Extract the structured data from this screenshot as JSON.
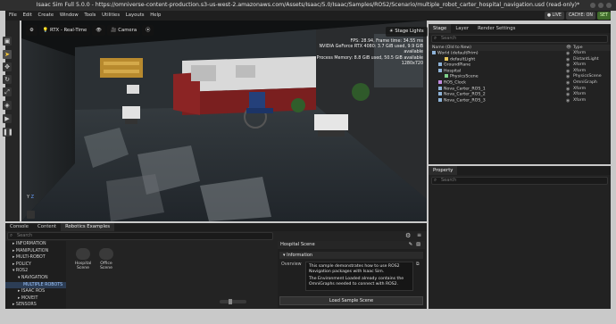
{
  "window": {
    "title": "Isaac Sim Full 5.0.0 - https://omniverse-content-production.s3-us-west-2.amazonaws.com/Assets/Isaac/5.0/Isaac/Samples/ROS2/Scenario/multiple_robot_carter_hospital_navigation.usd (read-only)*"
  },
  "menubar": {
    "items": [
      "File",
      "Edit",
      "Create",
      "Window",
      "Tools",
      "Utilities",
      "Layouts",
      "Help"
    ],
    "live_label": "LIVE",
    "cache_label": "CACHE: ON",
    "set_label": "SET"
  },
  "viewport": {
    "render_mode": "RTX - Real-Time",
    "camera_label": "Camera",
    "stage_lights_label": "Stage Lights",
    "stats": [
      "FPS: 28.94, Frame time: 34.55 ms",
      "NVIDIA GeForce RTX 4080: 3.7 GiB used, 9.9 GiB available",
      "Process Memory: 8.8 GiB used, 50.5 GiB available",
      "1280x720"
    ],
    "axis_label": "Y",
    "axis_label_2": "Z"
  },
  "stage": {
    "tabs": [
      "Stage",
      "Layer",
      "Render Settings"
    ],
    "search_placeholder": "Search",
    "col_name": "Name (Old to New)",
    "col_type": "Type",
    "rows": [
      {
        "label": "World (defaultPrim)",
        "type": "Xform",
        "indent": 0,
        "color": "#8fb4d9"
      },
      {
        "label": "defaultLight",
        "type": "DistantLight",
        "indent": 2,
        "color": "#e6c65a"
      },
      {
        "label": "GroundPlane",
        "type": "Xform",
        "indent": 1,
        "color": "#8fb4d9"
      },
      {
        "label": "Hospital",
        "type": "Xform",
        "indent": 1,
        "color": "#8fb4d9"
      },
      {
        "label": "PhysicsScene",
        "type": "PhysicsScene",
        "indent": 2,
        "color": "#7fd08a"
      },
      {
        "label": "ROS_Clock",
        "type": "OmniGraph",
        "indent": 1,
        "color": "#c28adf"
      },
      {
        "label": "Nova_Carter_ROS_1",
        "type": "Xform",
        "indent": 1,
        "color": "#8fb4d9"
      },
      {
        "label": "Nova_Carter_ROS_2",
        "type": "Xform",
        "indent": 1,
        "color": "#8fb4d9"
      },
      {
        "label": "Nova_Carter_ROS_3",
        "type": "Xform",
        "indent": 1,
        "color": "#8fb4d9"
      }
    ]
  },
  "property": {
    "tab": "Property",
    "search_placeholder": "Search"
  },
  "bottom": {
    "tabs": [
      "Console",
      "Content",
      "Robotics Examples"
    ],
    "search_placeholder": "Search",
    "tree": [
      {
        "label": "▸ INFORMATION",
        "indent": 0,
        "selected": false
      },
      {
        "label": "▸ MANIPULATION",
        "indent": 0,
        "selected": false
      },
      {
        "label": "▸ MULTI-ROBOT",
        "indent": 0,
        "selected": false
      },
      {
        "label": "▸ POLICY",
        "indent": 0,
        "selected": false
      },
      {
        "label": "▾ ROS2",
        "indent": 0,
        "selected": false
      },
      {
        "label": "▾ NAVIGATION",
        "indent": 1,
        "selected": false
      },
      {
        "label": "MULTIPLE ROBOTS",
        "indent": 2,
        "selected": true
      },
      {
        "label": "▸ ISAAC ROS",
        "indent": 1,
        "selected": false
      },
      {
        "label": "▸ MOVEIT",
        "indent": 1,
        "selected": false
      },
      {
        "label": "▸ SENSORS",
        "indent": 0,
        "selected": false
      }
    ],
    "tiles": [
      {
        "label1": "Hospital",
        "label2": "Scene"
      },
      {
        "label1": "Office",
        "label2": "Scene"
      }
    ],
    "scene": {
      "title": "Hospital Scene",
      "info_header": "▾ Information",
      "overview_label": "Overview",
      "desc1": "This sample demonstrates how to use ROS2 Navigation packages with Isaac Sim.",
      "desc2": "The Environment Loaded already contains the OmniGraphs needed to connect with ROS2.",
      "load_label": "Load Sample Scene"
    }
  }
}
